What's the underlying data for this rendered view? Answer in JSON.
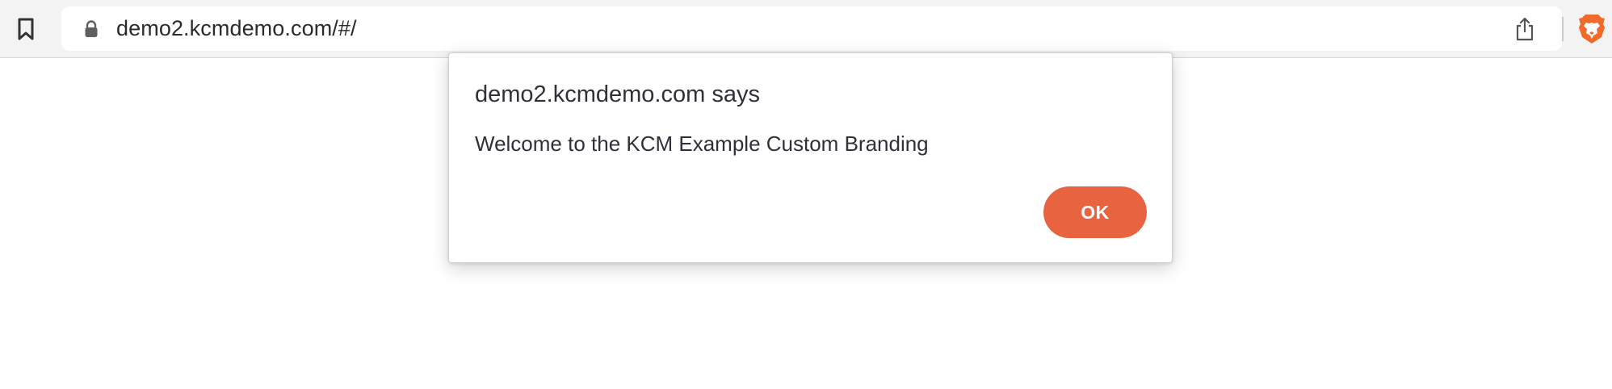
{
  "browser": {
    "url": "demo2.kcmdemo.com/#/",
    "icons": {
      "bookmark": "bookmark-icon",
      "lock": "lock-icon",
      "share": "share-icon",
      "brave": "brave-lion-icon"
    },
    "brand_color": "#f06a2a"
  },
  "dialog": {
    "title": "demo2.kcmdemo.com says",
    "message": "Welcome to the KCM Example Custom Branding",
    "ok_label": "OK",
    "ok_color": "#e8633f"
  }
}
